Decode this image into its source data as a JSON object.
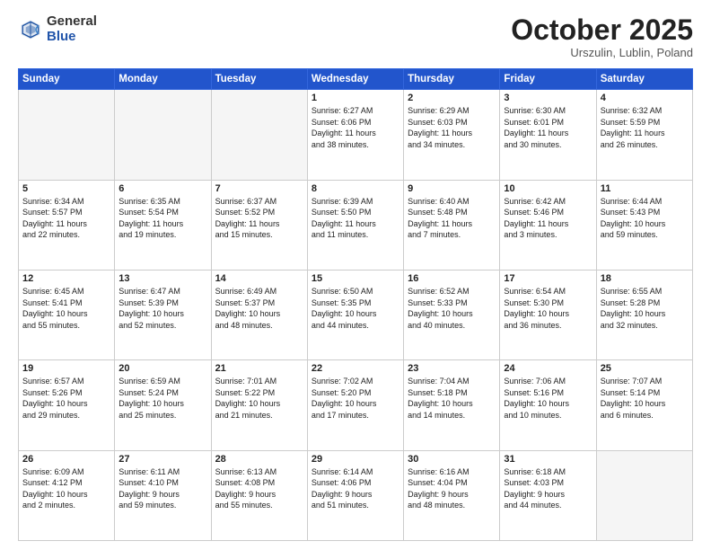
{
  "header": {
    "logo": {
      "general": "General",
      "blue": "Blue"
    },
    "title": "October 2025",
    "subtitle": "Urszulin, Lublin, Poland"
  },
  "weekdays": [
    "Sunday",
    "Monday",
    "Tuesday",
    "Wednesday",
    "Thursday",
    "Friday",
    "Saturday"
  ],
  "weeks": [
    [
      {
        "num": "",
        "info": ""
      },
      {
        "num": "",
        "info": ""
      },
      {
        "num": "",
        "info": ""
      },
      {
        "num": "1",
        "info": "Sunrise: 6:27 AM\nSunset: 6:06 PM\nDaylight: 11 hours\nand 38 minutes."
      },
      {
        "num": "2",
        "info": "Sunrise: 6:29 AM\nSunset: 6:03 PM\nDaylight: 11 hours\nand 34 minutes."
      },
      {
        "num": "3",
        "info": "Sunrise: 6:30 AM\nSunset: 6:01 PM\nDaylight: 11 hours\nand 30 minutes."
      },
      {
        "num": "4",
        "info": "Sunrise: 6:32 AM\nSunset: 5:59 PM\nDaylight: 11 hours\nand 26 minutes."
      }
    ],
    [
      {
        "num": "5",
        "info": "Sunrise: 6:34 AM\nSunset: 5:57 PM\nDaylight: 11 hours\nand 22 minutes."
      },
      {
        "num": "6",
        "info": "Sunrise: 6:35 AM\nSunset: 5:54 PM\nDaylight: 11 hours\nand 19 minutes."
      },
      {
        "num": "7",
        "info": "Sunrise: 6:37 AM\nSunset: 5:52 PM\nDaylight: 11 hours\nand 15 minutes."
      },
      {
        "num": "8",
        "info": "Sunrise: 6:39 AM\nSunset: 5:50 PM\nDaylight: 11 hours\nand 11 minutes."
      },
      {
        "num": "9",
        "info": "Sunrise: 6:40 AM\nSunset: 5:48 PM\nDaylight: 11 hours\nand 7 minutes."
      },
      {
        "num": "10",
        "info": "Sunrise: 6:42 AM\nSunset: 5:46 PM\nDaylight: 11 hours\nand 3 minutes."
      },
      {
        "num": "11",
        "info": "Sunrise: 6:44 AM\nSunset: 5:43 PM\nDaylight: 10 hours\nand 59 minutes."
      }
    ],
    [
      {
        "num": "12",
        "info": "Sunrise: 6:45 AM\nSunset: 5:41 PM\nDaylight: 10 hours\nand 55 minutes."
      },
      {
        "num": "13",
        "info": "Sunrise: 6:47 AM\nSunset: 5:39 PM\nDaylight: 10 hours\nand 52 minutes."
      },
      {
        "num": "14",
        "info": "Sunrise: 6:49 AM\nSunset: 5:37 PM\nDaylight: 10 hours\nand 48 minutes."
      },
      {
        "num": "15",
        "info": "Sunrise: 6:50 AM\nSunset: 5:35 PM\nDaylight: 10 hours\nand 44 minutes."
      },
      {
        "num": "16",
        "info": "Sunrise: 6:52 AM\nSunset: 5:33 PM\nDaylight: 10 hours\nand 40 minutes."
      },
      {
        "num": "17",
        "info": "Sunrise: 6:54 AM\nSunset: 5:30 PM\nDaylight: 10 hours\nand 36 minutes."
      },
      {
        "num": "18",
        "info": "Sunrise: 6:55 AM\nSunset: 5:28 PM\nDaylight: 10 hours\nand 32 minutes."
      }
    ],
    [
      {
        "num": "19",
        "info": "Sunrise: 6:57 AM\nSunset: 5:26 PM\nDaylight: 10 hours\nand 29 minutes."
      },
      {
        "num": "20",
        "info": "Sunrise: 6:59 AM\nSunset: 5:24 PM\nDaylight: 10 hours\nand 25 minutes."
      },
      {
        "num": "21",
        "info": "Sunrise: 7:01 AM\nSunset: 5:22 PM\nDaylight: 10 hours\nand 21 minutes."
      },
      {
        "num": "22",
        "info": "Sunrise: 7:02 AM\nSunset: 5:20 PM\nDaylight: 10 hours\nand 17 minutes."
      },
      {
        "num": "23",
        "info": "Sunrise: 7:04 AM\nSunset: 5:18 PM\nDaylight: 10 hours\nand 14 minutes."
      },
      {
        "num": "24",
        "info": "Sunrise: 7:06 AM\nSunset: 5:16 PM\nDaylight: 10 hours\nand 10 minutes."
      },
      {
        "num": "25",
        "info": "Sunrise: 7:07 AM\nSunset: 5:14 PM\nDaylight: 10 hours\nand 6 minutes."
      }
    ],
    [
      {
        "num": "26",
        "info": "Sunrise: 6:09 AM\nSunset: 4:12 PM\nDaylight: 10 hours\nand 2 minutes."
      },
      {
        "num": "27",
        "info": "Sunrise: 6:11 AM\nSunset: 4:10 PM\nDaylight: 9 hours\nand 59 minutes."
      },
      {
        "num": "28",
        "info": "Sunrise: 6:13 AM\nSunset: 4:08 PM\nDaylight: 9 hours\nand 55 minutes."
      },
      {
        "num": "29",
        "info": "Sunrise: 6:14 AM\nSunset: 4:06 PM\nDaylight: 9 hours\nand 51 minutes."
      },
      {
        "num": "30",
        "info": "Sunrise: 6:16 AM\nSunset: 4:04 PM\nDaylight: 9 hours\nand 48 minutes."
      },
      {
        "num": "31",
        "info": "Sunrise: 6:18 AM\nSunset: 4:03 PM\nDaylight: 9 hours\nand 44 minutes."
      },
      {
        "num": "",
        "info": ""
      }
    ]
  ]
}
